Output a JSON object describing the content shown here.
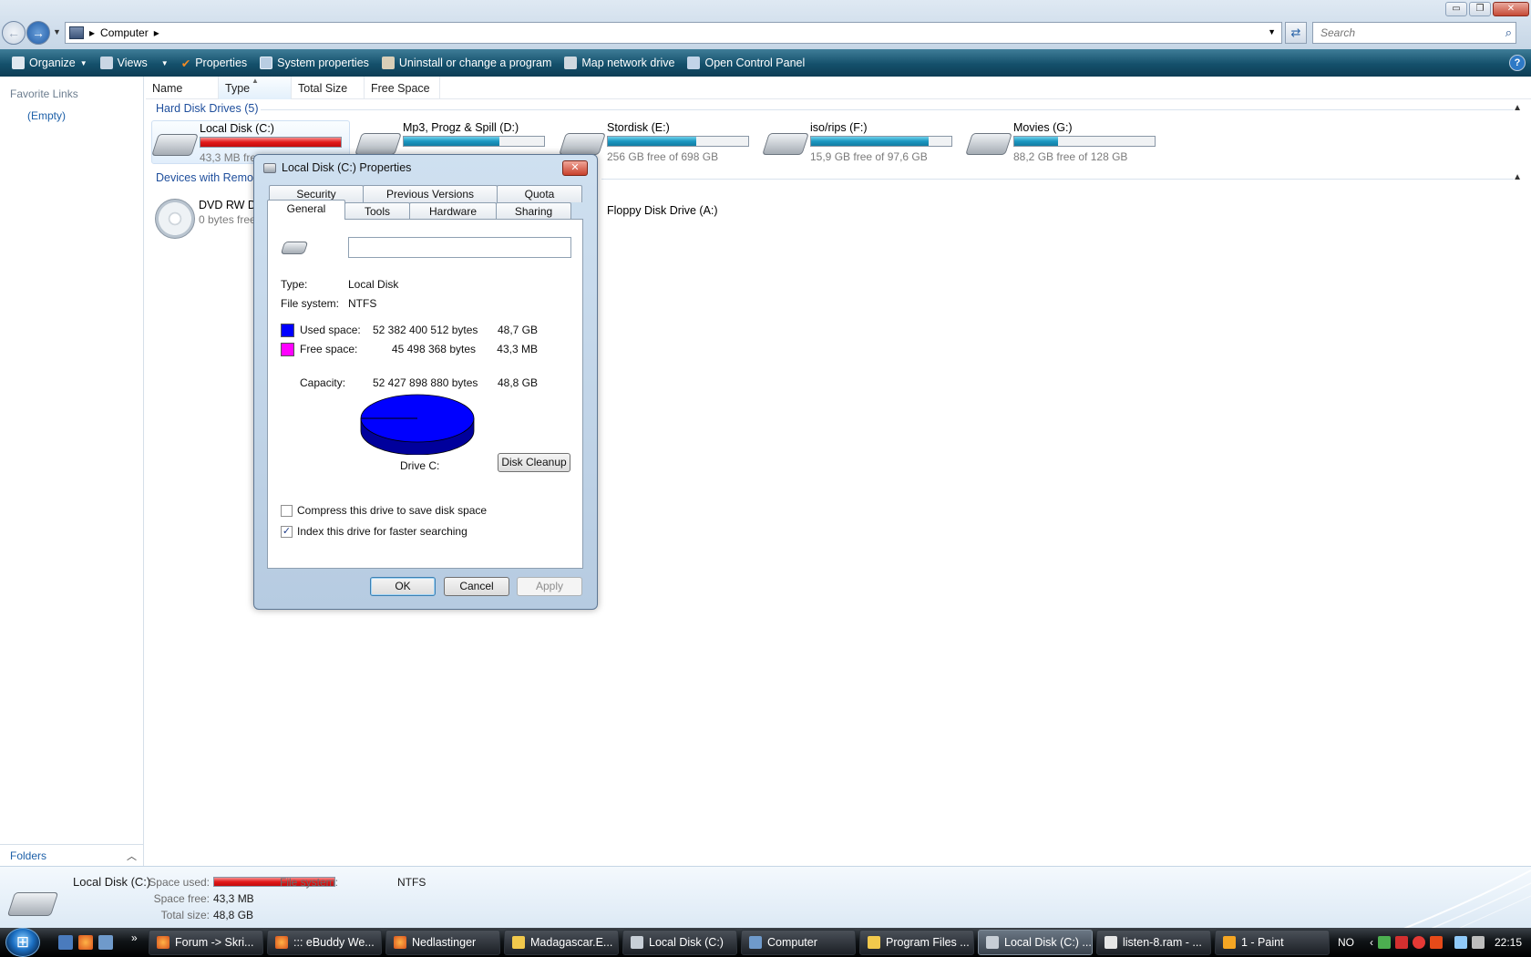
{
  "address_bar": {
    "breadcrumb": "Computer",
    "search_placeholder": "Search"
  },
  "window_buttons": {
    "minimize": "▭",
    "maximize": "❐",
    "close": "✕"
  },
  "toolbar": {
    "organize": "Organize",
    "views": "Views",
    "properties": "Properties",
    "system_properties": "System properties",
    "uninstall": "Uninstall or change a program",
    "map_drive": "Map network drive",
    "control_panel": "Open Control Panel",
    "help": "?"
  },
  "nav_pane": {
    "favorite_links": "Favorite Links",
    "empty": "(Empty)",
    "folders": "Folders"
  },
  "columns": [
    "Name",
    "Type",
    "Total Size",
    "Free Space"
  ],
  "groups": {
    "hard_disks": "Hard Disk Drives (5)",
    "removable": "Devices with Removable Storage (2)",
    "removable_visible": "Devices with Remov"
  },
  "drives": [
    {
      "name": "Local Disk (C:)",
      "free_text": "43,3 MB free of 48,8 GB",
      "free_visible": "43,3 MB fre",
      "used_fraction": 0.999,
      "bar_color": "red"
    },
    {
      "name": "Mp3, Progz & Spill (D:)",
      "used_fraction": 0.68,
      "bar_color": "blue"
    },
    {
      "name": "Stordisk (E:)",
      "free_text": "256 GB free of 698 GB",
      "used_fraction": 0.63,
      "bar_color": "blue"
    },
    {
      "name": "iso/rips (F:)",
      "free_text": "15,9 GB free of 97,6 GB",
      "used_fraction": 0.84,
      "bar_color": "blue"
    },
    {
      "name": "Movies (G:)",
      "free_text": "88,2 GB free of 128 GB",
      "used_fraction": 0.31,
      "bar_color": "blue"
    }
  ],
  "removable": [
    {
      "name": "DVD RW Dr",
      "free_text": "0 bytes free"
    },
    {
      "name": "Floppy Disk Drive (A:)"
    }
  ],
  "dialog": {
    "title": "Local Disk (C:) Properties",
    "tabs_row1": [
      "Security",
      "Previous Versions",
      "Quota"
    ],
    "tabs_row2": [
      "General",
      "Tools",
      "Hardware",
      "Sharing"
    ],
    "active_tab": "General",
    "label_value": "",
    "type_label": "Type:",
    "type_value": "Local Disk",
    "fs_label": "File system:",
    "fs_value": "NTFS",
    "used_label": "Used space:",
    "used_bytes": "52 382 400 512 bytes",
    "used_gb": "48,7 GB",
    "free_label": "Free space:",
    "free_bytes": "45 498 368 bytes",
    "free_gb": "43,3 MB",
    "capacity_label": "Capacity:",
    "capacity_bytes": "52 427 898 880 bytes",
    "capacity_gb": "48,8 GB",
    "drive_label": "Drive C:",
    "disk_cleanup": "Disk Cleanup",
    "compress_label": "Compress this drive to save disk space",
    "compress_checked": false,
    "index_label": "Index this drive for faster searching",
    "index_checked": true,
    "ok": "OK",
    "cancel": "Cancel",
    "apply": "Apply",
    "used_color": "#0000ff",
    "free_color": "#ff00ff"
  },
  "details": {
    "name": "Local Disk (C:)",
    "space_used_label": "Space used:",
    "space_free_label": "Space free:",
    "space_free": "43,3 MB",
    "total_size_label": "Total size:",
    "total_size": "48,8 GB",
    "fs_label": "File system:",
    "fs_value": "NTFS"
  },
  "taskbar": {
    "tasks": [
      {
        "label": "Forum -> Skri...",
        "icon": "firefox-icon"
      },
      {
        "label": "::: eBuddy We...",
        "icon": "firefox-icon"
      },
      {
        "label": "Nedlastinger",
        "icon": "firefox-icon"
      },
      {
        "label": "Madagascar.E...",
        "icon": "folder-icon"
      },
      {
        "label": "Local Disk (C:)",
        "icon": "drive-icon"
      },
      {
        "label": "Computer",
        "icon": "computer-icon"
      },
      {
        "label": "Program Files ...",
        "icon": "folder-icon"
      },
      {
        "label": "Local Disk (C:) ...",
        "icon": "drive-icon",
        "active": true
      },
      {
        "label": "listen-8.ram - ...",
        "icon": "notepad-icon"
      },
      {
        "label": "1 - Paint",
        "icon": "paint-icon"
      }
    ],
    "lang": "NO",
    "clock": "22:15"
  }
}
